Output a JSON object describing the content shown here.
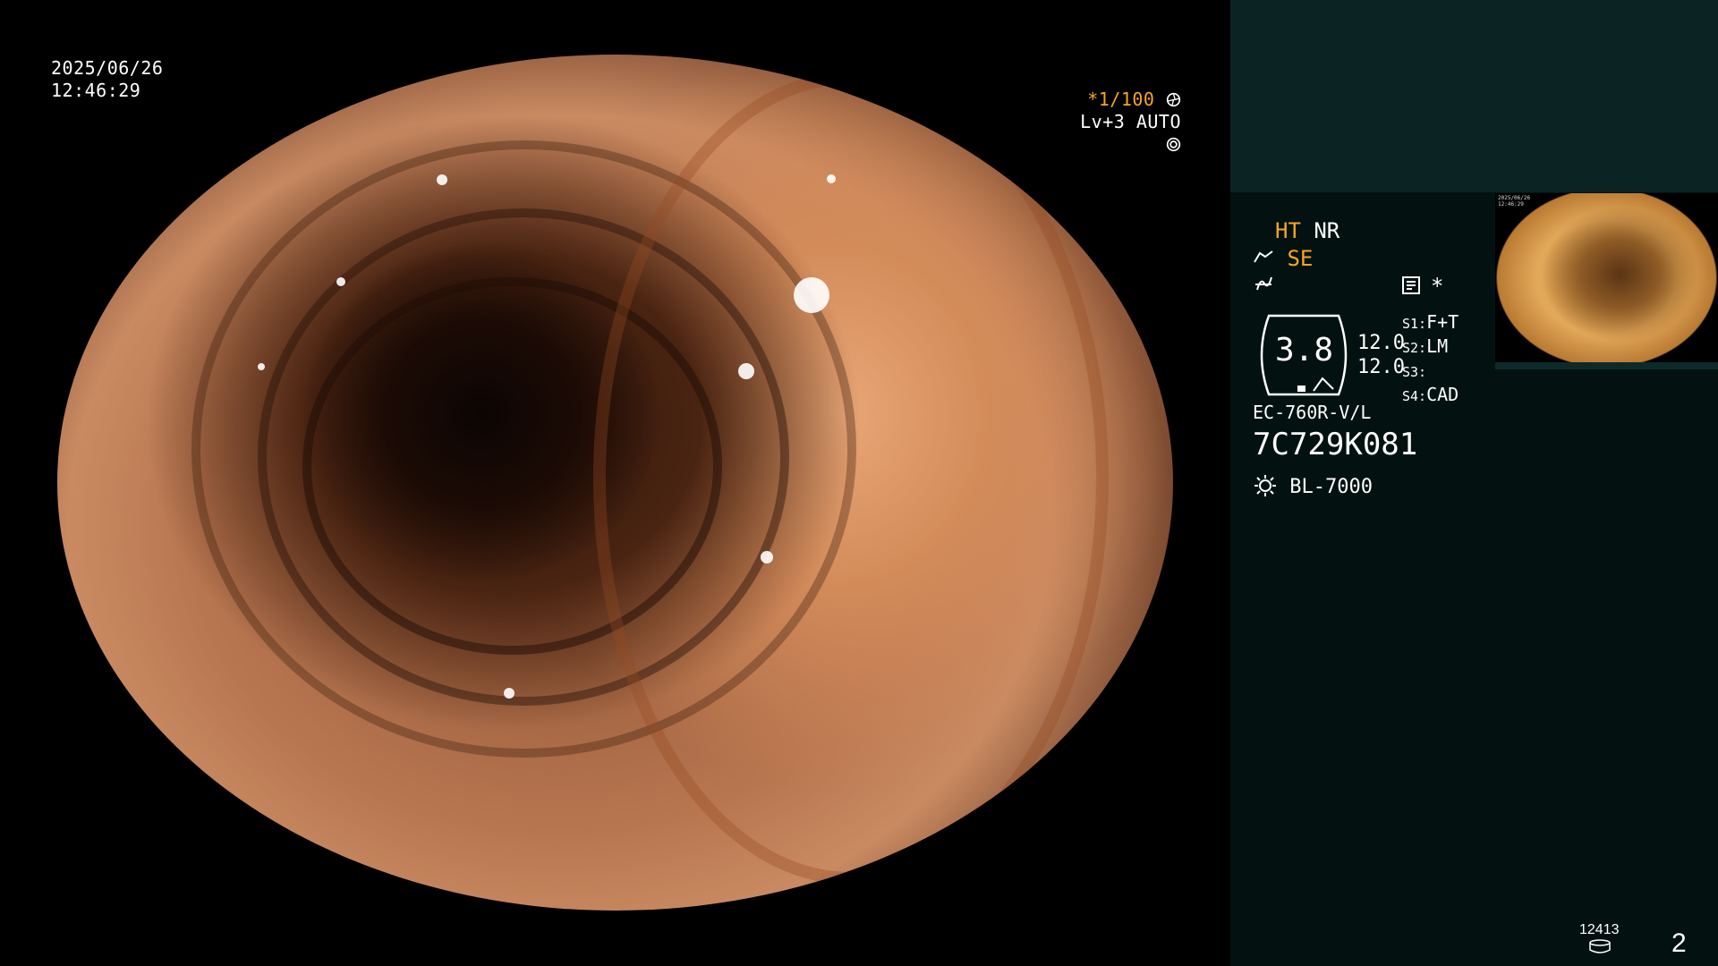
{
  "scope_osd": {
    "date": "2025/06/26",
    "time": "12:46:29",
    "shutter": "*1/100",
    "shutter_icon": "aperture-icon",
    "level": "Lv+3 AUTO",
    "auto_icon": "iris-icon"
  },
  "panel": {
    "ht": "HT",
    "nr": "NR",
    "se": "SE",
    "se_icon": "scope-tip-icon",
    "f_icon": "flicker-icon",
    "memory_icon": "memory-card-icon",
    "asterisk": "*",
    "zoom_value": "3.8",
    "values": [
      "12.0",
      "12.0"
    ],
    "switches": [
      {
        "key": "S1:",
        "value": "F+T"
      },
      {
        "key": "S2:",
        "value": "LM"
      },
      {
        "key": "S3:",
        "value": ""
      },
      {
        "key": "S4:",
        "value": "CAD"
      }
    ],
    "scope_model": "EC-760R-V/L",
    "serial": "7C729K081",
    "light_icon": "light-source-icon",
    "light_source": "BL-7000",
    "counter": "12413",
    "counter_icon": "disk-icon",
    "page_number": "2"
  },
  "colors": {
    "accent": "#f5a623",
    "panel_top": "#0c2324",
    "panel_body": "#031210"
  }
}
